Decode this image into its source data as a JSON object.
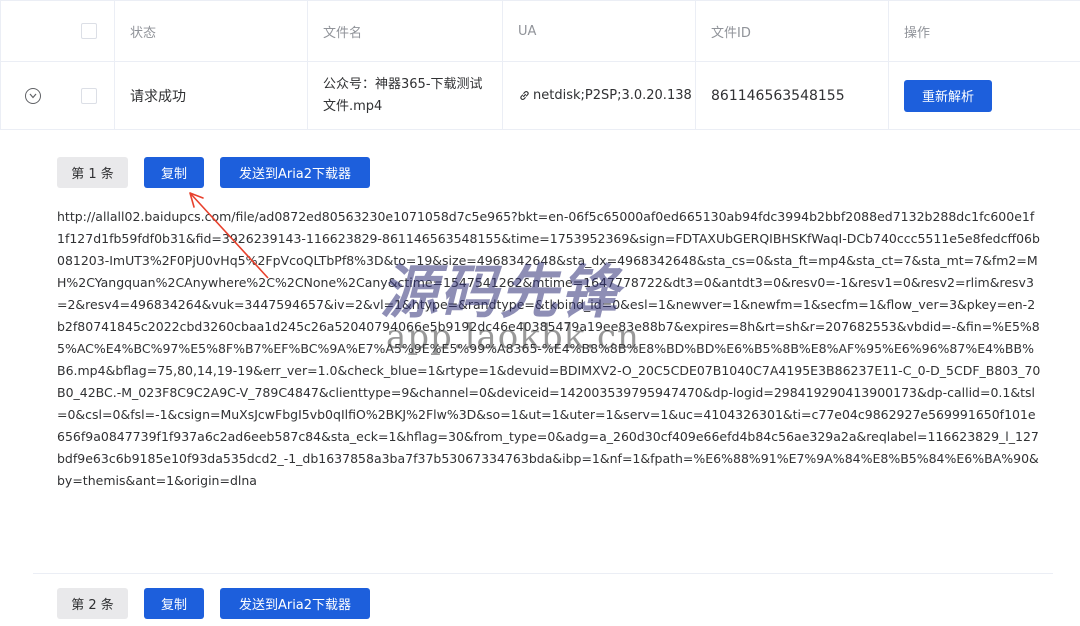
{
  "table": {
    "headers": {
      "status": "状态",
      "filename": "文件名",
      "ua": "UA",
      "file_id": "文件ID",
      "action": "操作"
    },
    "row": {
      "status": "请求成功",
      "filename": "公众号：神器365-下载测试文件.mp4",
      "ua": "netdisk;P2SP;3.0.20.138",
      "file_id": "861146563548155",
      "reparse_label": "重新解析"
    }
  },
  "entries": [
    {
      "tag": "第 1 条",
      "copy_label": "复制",
      "aria_label": "发送到Aria2下载器",
      "url": "http://allall02.baidupcs.com/file/ad0872ed80563230e1071058d7c5e965?bkt=en-06f5c65000af0ed665130ab94fdc3994b2bbf2088ed7132b288dc1fc600e1f1f127d1fb59fdf0b31&fid=3926239143-116623829-861146563548155&time=1753952369&sign=FDTAXUbGERQIBHSKfWaqI-DCb740ccc5511e5e8fedcff06b081203-ImUT3%2F0PjU0vHq5%2FpVcoQLTbPf8%3D&to=19&size=4968342648&sta_dx=4968342648&sta_cs=0&sta_ft=mp4&sta_ct=7&sta_mt=7&fm2=MH%2CYangquan%2CAnywhere%2C%2CNone%2Cany&ctime=1547541262&mtime=1647778722&dt3=0&antdt3=0&resv0=-1&resv1=0&resv2=rlim&resv3=2&resv4=496834264&vuk=3447594657&iv=2&vl=1&htype=&randtype=&tkbind_id=0&esl=1&newver=1&newfm=1&secfm=1&flow_ver=3&pkey=en-2b2f80741845c2022cbd3260cbaa1d245c26a52040794066e5b9192dc46e40385479a19ee83e88b7&expires=8h&rt=sh&r=207682553&vbdid=-&fin=%E5%85%AC%E4%BC%97%E5%8F%B7%EF%BC%9A%E7%A5%9E%E5%99%A8365-%E4%B8%8B%E8%BD%BD%E6%B5%8B%E8%AF%95%E6%96%87%E4%BB%B6.mp4&bflag=75,80,14,19-19&err_ver=1.0&check_blue=1&rtype=1&devuid=BDIMXV2-O_20C5CDE07B1040C7A4195E3B86237E11-C_0-D_5CDF_B803_70B0_42BC.-M_023F8C9C2A9C-V_789C4847&clienttype=9&channel=0&deviceid=142003539795947470&dp-logid=298419290413900173&dp-callid=0.1&tsl=0&csl=0&fsl=-1&csign=MuXsJcwFbgI5vb0qIlfiO%2BKJ%2Flw%3D&so=1&ut=1&uter=1&serv=1&uc=4104326301&ti=c77e04c9862927e569991650f101e656f9a0847739f1f937a6c2ad6eeb587c84&sta_eck=1&hflag=30&from_type=0&adg=a_260d30cf409e66efd4b84c56ae329a2a&reqlabel=116623829_l_127bdf9e63c6b9185e10f93da535dcd2_-1_db1637858a3ba7f37b53067334763bda&ibp=1&nf=1&fpath=%E6%88%91%E7%9A%84%E8%B5%84%E6%BA%90&by=themis&ant=1&origin=dlna"
    },
    {
      "tag": "第 2 条",
      "copy_label": "复制",
      "aria_label": "发送到Aria2下载器"
    }
  ],
  "watermark": {
    "title": "源码先锋",
    "subtitle": "app.laokbk.cn"
  },
  "icons": {
    "expand": "chevron-down-icon",
    "ua_link": "link-icon",
    "annotation": "red-arrow"
  },
  "colors": {
    "primary_button": "#1d5fdc",
    "tag_bg": "#e9e9eb",
    "annotation_arrow": "#e8412d"
  }
}
